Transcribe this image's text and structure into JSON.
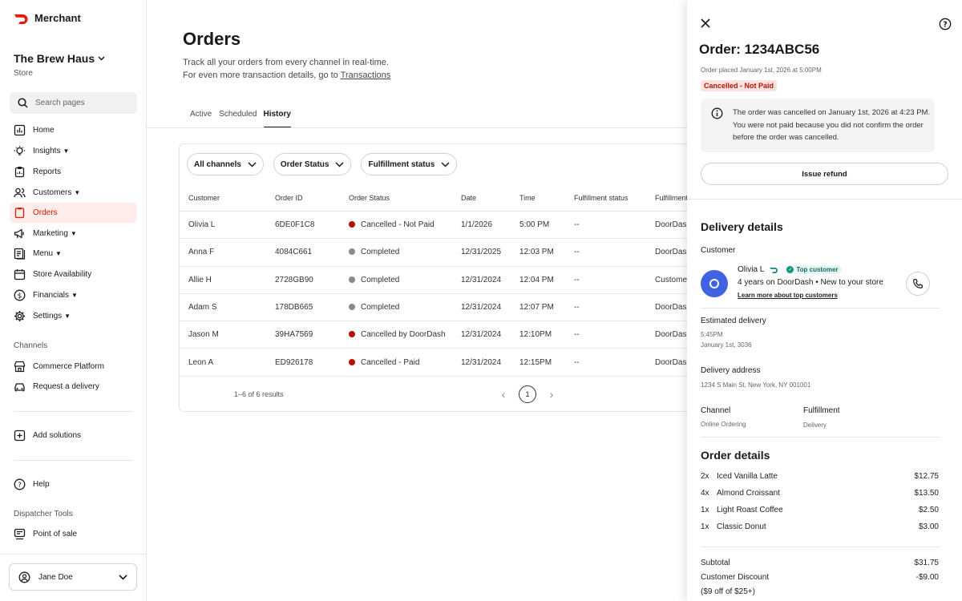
{
  "app": {
    "brand": "Merchant",
    "brand_color": "#eb1700"
  },
  "store": {
    "name": "The Brew Haus",
    "type": "Store"
  },
  "search": {
    "placeholder": "Search pages"
  },
  "nav": {
    "home": "Home",
    "insights": "Insights",
    "reports": "Reports",
    "customers": "Customers",
    "orders": "Orders",
    "marketing": "Marketing",
    "menu": "Menu",
    "store_availability": "Store Availability",
    "financials": "Financials",
    "settings": "Settings",
    "channels_label": "Channels",
    "commerce_platform": "Commerce Platform",
    "request_delivery": "Request a delivery",
    "add_solutions": "Add solutions",
    "help": "Help",
    "dispatcher_label": "Dispatcher Tools",
    "point_of_sale": "Point of sale"
  },
  "user": {
    "name": "Jane Doe"
  },
  "page": {
    "title": "Orders",
    "desc_line1": "Track all your orders from every channel in real-time.",
    "desc_line2": "For even more transaction details, go to",
    "desc_link": "Transactions"
  },
  "tabs": {
    "active": "Active",
    "scheduled": "Scheduled",
    "history": "History"
  },
  "filters": {
    "channels": "All channels",
    "status": "Order Status",
    "fulfillment": "Fulfillment status"
  },
  "table": {
    "headers": {
      "customer": "Customer",
      "order_id": "Order ID",
      "order_status": "Order Status",
      "date": "Date",
      "time": "Time",
      "fulfillment_status": "Fulfillment status",
      "fulfillment": "Fulfillment"
    },
    "rows": [
      {
        "customer": "Olivia L",
        "order_id": "6DE0F1C8",
        "status": "Cancelled - Not Paid",
        "status_color": "#b71000",
        "date": "1/1/2026",
        "time": "5:00 PM",
        "fstatus": "--",
        "fulfillment": "DoorDash"
      },
      {
        "customer": "Anna F",
        "order_id": "4084C661",
        "status": "Completed",
        "status_color": "#8a8a8a",
        "date": "12/31/2025",
        "time": "12:03 PM",
        "fstatus": "--",
        "fulfillment": "DoorDash"
      },
      {
        "customer": "Allie H",
        "order_id": "2728GB90",
        "status": "Completed",
        "status_color": "#8a8a8a",
        "date": "12/31/2024",
        "time": "12:04 PM",
        "fstatus": "--",
        "fulfillment": "Customer"
      },
      {
        "customer": "Adam S",
        "order_id": "178DB665",
        "status": "Completed",
        "status_color": "#8a8a8a",
        "date": "12/31/2024",
        "time": "12:07 PM",
        "fstatus": "--",
        "fulfillment": "DoorDash"
      },
      {
        "customer": "Jason M",
        "order_id": "39HA7569",
        "status": "Cancelled by DoorDash",
        "status_color": "#b71000",
        "date": "12/31/2024",
        "time": "12:10PM",
        "fstatus": "--",
        "fulfillment": "DoorDash"
      },
      {
        "customer": "Leon A",
        "order_id": "ED926178",
        "status": "Cancelled - Paid",
        "status_color": "#b71000",
        "date": "12/31/2024",
        "time": "12:15PM",
        "fstatus": "--",
        "fulfillment": "DoorDash"
      }
    ],
    "results": "1–6 of 6 results",
    "current_page": "1"
  },
  "panel": {
    "title": "Order: 1234ABC56",
    "placed": "Order placed January 1st, 2026 at 5:00PM",
    "badge": "Cancelled - Not Paid",
    "info": "The order was cancelled on January 1st, 2026 at 4:23 PM. You were not paid because you did not confirm the order before the order was cancelled.",
    "refund_label": "Issue refund",
    "delivery_heading": "Delivery details",
    "customer_label": "Customer",
    "customer_name": "Olivia L",
    "top_customer": "Top customer",
    "customer_years": "4 years on DoorDash • New to your store",
    "learn_more": "Learn more about top customers",
    "est_label": "Estimated delivery",
    "est_time": "5:45PM",
    "est_date": "January 1st, 3036",
    "address_label": "Delivery address",
    "address": "1234 S Main St, New York, NY 001001",
    "channel_label": "Channel",
    "channel_value": "Online Ordering",
    "fulfillment_label": "Fulfillment",
    "fulfillment_value": "Delivery",
    "order_heading": "Order details",
    "items": [
      {
        "qty": "2x",
        "name": "Iced Vanilla Latte",
        "price": "$12.75"
      },
      {
        "qty": "4x",
        "name": "Almond Croissant",
        "price": "$13.50"
      },
      {
        "qty": "1x",
        "name": "Light Roast Coffee",
        "price": "$2.50"
      },
      {
        "qty": "1x",
        "name": "Classic Donut",
        "price": "$3.00"
      }
    ],
    "subtotal_label": "Subtotal",
    "subtotal": "$31.75",
    "discount_label": "Customer Discount",
    "discount": "-$9.00",
    "discount_note": "($9 off of $25+)"
  }
}
